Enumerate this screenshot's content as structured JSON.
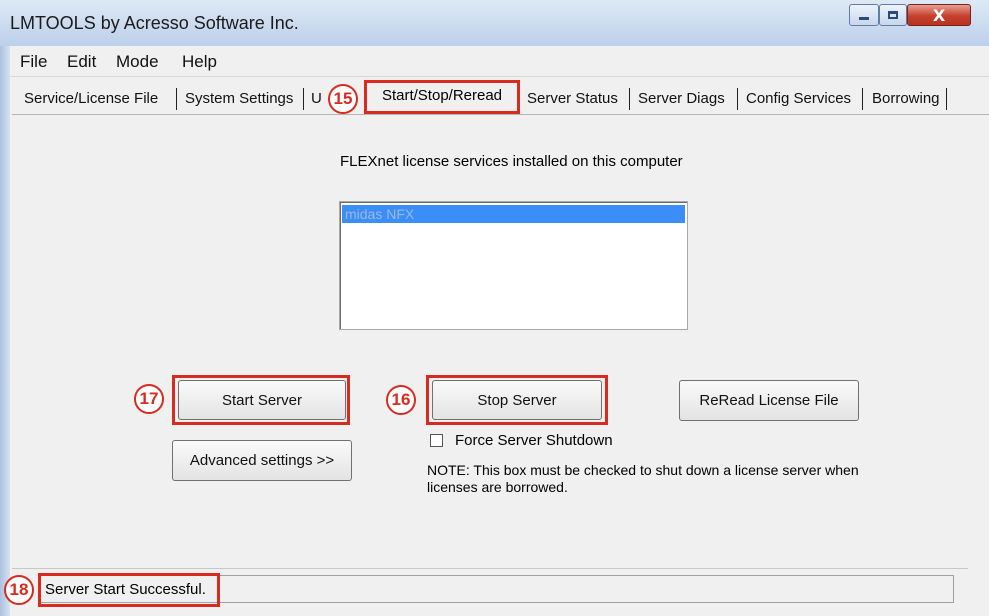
{
  "window": {
    "title": "LMTOOLS by Acresso Software Inc.",
    "accent_color": "#d92a1f"
  },
  "caption_buttons": {
    "minimize_icon": "minimize-icon",
    "maximize_icon": "maximize-icon",
    "close_icon": "close-icon",
    "close_glyph": "X"
  },
  "menu": {
    "items": [
      "File",
      "Edit",
      "Mode",
      "Help"
    ]
  },
  "tabs": {
    "items": [
      "Service/License File",
      "System Settings",
      "U",
      "Start/Stop/Reread",
      "Server Status",
      "Server Diags",
      "Config Services",
      "Borrowing"
    ],
    "active": "Start/Stop/Reread"
  },
  "main": {
    "services_heading": "FLEXnet license services installed on this computer",
    "services": [
      "midas NFX"
    ],
    "start_label": "Start Server",
    "stop_label": "Stop Server",
    "reread_label": "ReRead License File",
    "advanced_label": "Advanced settings >>",
    "force_label": "Force Server Shutdown",
    "force_checked": false,
    "note": "NOTE:  This box must be checked to shut down a license server when licenses are borrowed."
  },
  "status": {
    "text": "Server Start Successful."
  },
  "markers": {
    "m15": "15",
    "m16": "16",
    "m17": "17",
    "m18": "18"
  }
}
